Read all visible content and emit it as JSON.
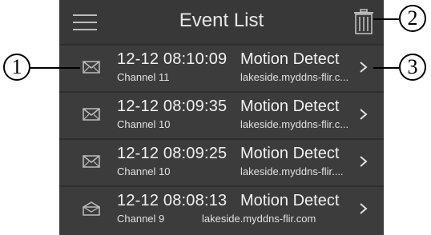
{
  "header": {
    "title": "Event List"
  },
  "events": [
    {
      "date": "12-12 08:10:09",
      "event": "Motion Detect",
      "channel": "Channel 11",
      "host": "lakeside.myddns-flir.c...",
      "icon": "envelope-closed-icon"
    },
    {
      "date": "12-12 08:09:35",
      "event": "Motion Detect",
      "channel": "Channel 10",
      "host": "lakeside.myddns-flir.c...",
      "icon": "envelope-closed-icon"
    },
    {
      "date": "12-12 08:09:25",
      "event": "Motion Detect",
      "channel": "Channel 10",
      "host": "lakeside.myddns-flir....",
      "icon": "envelope-closed-icon"
    },
    {
      "date": "12-12 08:08:13",
      "event": "Motion Detect",
      "channel": "Channel 9",
      "host": "lakeside.myddns-flir.com",
      "icon": "envelope-open-icon"
    }
  ],
  "callouts": {
    "one": "1",
    "two": "2",
    "three": "3"
  }
}
